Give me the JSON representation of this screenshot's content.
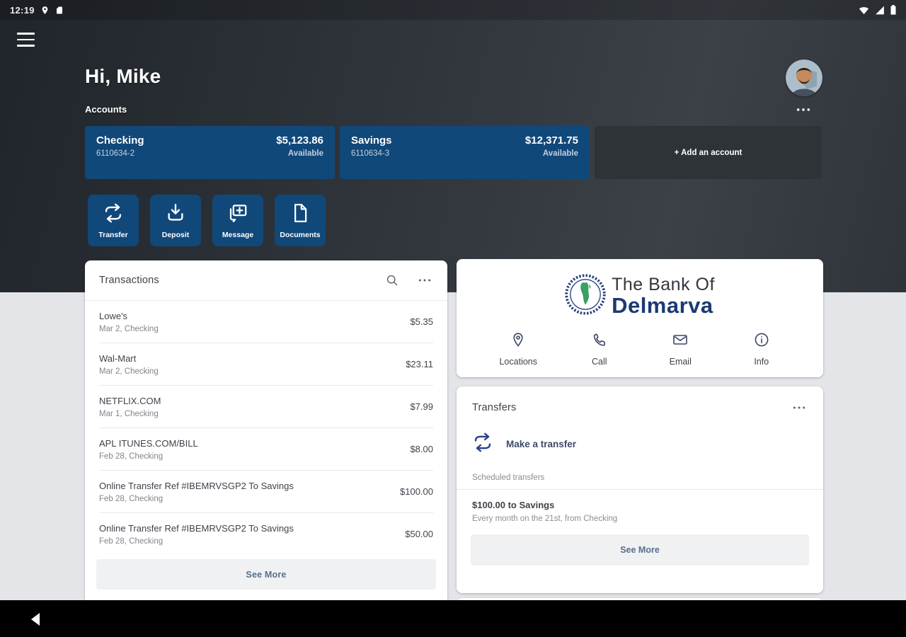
{
  "status_bar": {
    "time": "12:19"
  },
  "header": {
    "greeting": "Hi, Mike",
    "section_label": "Accounts"
  },
  "accounts": {
    "cards": [
      {
        "name": "Checking",
        "number": "6110634-2",
        "amount": "$5,123.86",
        "availability": "Available"
      },
      {
        "name": "Savings",
        "number": "6110634-3",
        "amount": "$12,371.75",
        "availability": "Available"
      }
    ],
    "add_button_label": "+ Add an account"
  },
  "quick_actions": [
    {
      "label": "Transfer"
    },
    {
      "label": "Deposit"
    },
    {
      "label": "Message"
    },
    {
      "label": "Documents"
    }
  ],
  "transactions": {
    "title": "Transactions",
    "rows": [
      {
        "merchant": "Lowe's",
        "meta": "Mar 2, Checking",
        "amount": "$5.35"
      },
      {
        "merchant": "Wal-Mart",
        "meta": "Mar 2, Checking",
        "amount": "$23.11"
      },
      {
        "merchant": "NETFLIX.COM",
        "meta": "Mar 1, Checking",
        "amount": "$7.99"
      },
      {
        "merchant": "APL ITUNES.COM/BILL",
        "meta": "Feb 28, Checking",
        "amount": "$8.00"
      },
      {
        "merchant": "Online Transfer Ref #IBEMRVSGP2 To Savings",
        "meta": "Feb 28, Checking",
        "amount": "$100.00"
      },
      {
        "merchant": "Online Transfer Ref #IBEMRVSGP2 To Savings",
        "meta": "Feb 28, Checking",
        "amount": "$50.00"
      }
    ],
    "see_more_label": "See More"
  },
  "bank": {
    "name_line1": "The Bank Of",
    "name_line2": "Delmarva",
    "contacts": [
      {
        "label": "Locations"
      },
      {
        "label": "Call"
      },
      {
        "label": "Email"
      },
      {
        "label": "Info"
      }
    ]
  },
  "transfers": {
    "title": "Transfers",
    "make_transfer_label": "Make a transfer",
    "scheduled_heading": "Scheduled transfers",
    "scheduled": [
      {
        "title": "$100.00 to Savings",
        "meta": "Every month on the 21st, from Checking"
      }
    ],
    "see_more_label": "See More"
  },
  "colors": {
    "account_card_blue": "#11487a",
    "brand_navy": "#1b3a70",
    "seal_green": "#3c9e63",
    "see_more_text": "#56708c",
    "background_dark": "#2d3237",
    "background_light": "#e3e5e8"
  }
}
